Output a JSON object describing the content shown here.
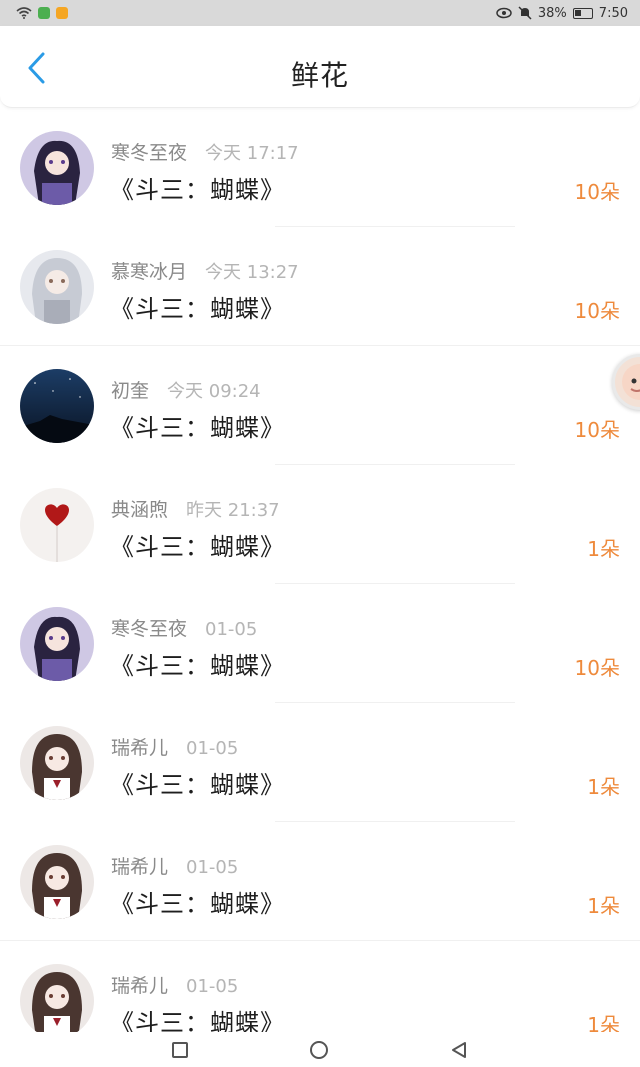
{
  "status_bar": {
    "battery": "38%",
    "time": "7:50"
  },
  "header": {
    "title": "鲜花"
  },
  "items": [
    {
      "name": "寒冬至夜",
      "time": "今天 17:17",
      "book": "《斗三：蝴蝶》",
      "count": "10朵",
      "avatar": "anime-girl-purple-avatar"
    },
    {
      "name": "慕寒冰月",
      "time": "今天 13:27",
      "book": "《斗三：蝴蝶》",
      "count": "10朵",
      "avatar": "anime-girl-silver-avatar"
    },
    {
      "name": "初奎",
      "time": "今天 09:24",
      "book": "《斗三：蝴蝶》",
      "count": "10朵",
      "avatar": "night-sky-avatar"
    },
    {
      "name": "典涵煦",
      "time": "昨天 21:37",
      "book": "《斗三：蝴蝶》",
      "count": "1朵",
      "avatar": "red-heart-avatar"
    },
    {
      "name": "寒冬至夜",
      "time": "01-05",
      "book": "《斗三：蝴蝶》",
      "count": "10朵",
      "avatar": "anime-girl-purple-avatar"
    },
    {
      "name": "瑞希儿",
      "time": "01-05",
      "book": "《斗三：蝴蝶》",
      "count": "1朵",
      "avatar": "anime-girl-brown-avatar"
    },
    {
      "name": "瑞希儿",
      "time": "01-05",
      "book": "《斗三：蝴蝶》",
      "count": "1朵",
      "avatar": "anime-girl-brown-avatar"
    },
    {
      "name": "瑞希儿",
      "time": "01-05",
      "book": "《斗三：蝴蝶》",
      "count": "1朵",
      "avatar": "anime-girl-brown-avatar"
    }
  ],
  "colors": {
    "accent_blue": "#2a9be6",
    "count_orange": "#ee8a3c"
  }
}
